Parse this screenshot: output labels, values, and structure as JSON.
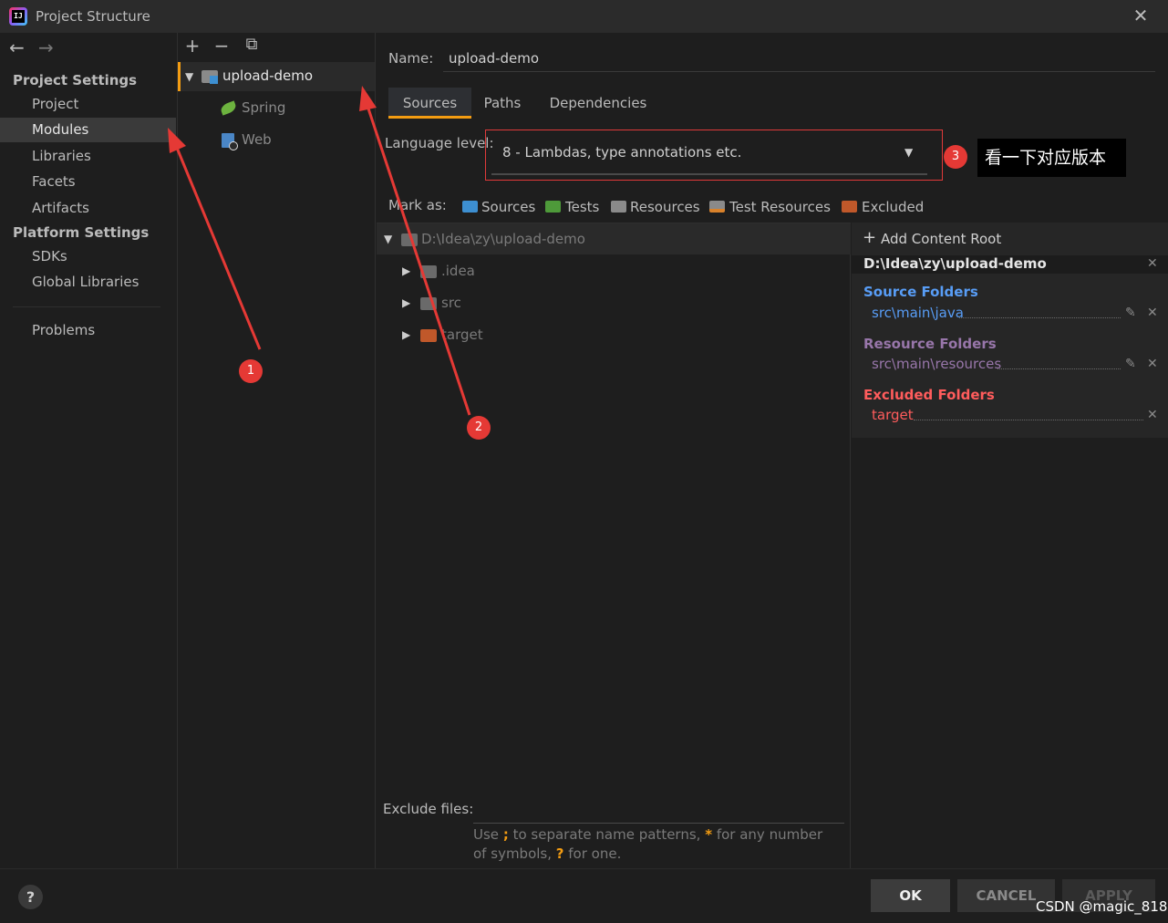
{
  "window": {
    "title": "Project Structure",
    "logo_text": "IJ"
  },
  "nav": {
    "back": "←",
    "forward": "→",
    "project_settings_heading": "Project Settings",
    "items": [
      "Project",
      "Modules",
      "Libraries",
      "Facets",
      "Artifacts"
    ],
    "platform_settings_heading": "Platform Settings",
    "platform_items": [
      "SDKs",
      "Global Libraries"
    ],
    "problems": "Problems"
  },
  "module_toolbar": {
    "add": "+",
    "remove": "−",
    "copy": "⧉"
  },
  "module_tree": {
    "module_name": "upload-demo",
    "children": [
      "Spring",
      "Web"
    ]
  },
  "details": {
    "name_label": "Name:",
    "name_value": "upload-demo",
    "tabs": [
      "Sources",
      "Paths",
      "Dependencies"
    ],
    "language_level_label": "Language level:",
    "language_level_value": "8 - Lambdas, type annotations etc.",
    "mark_as_label": "Mark as:",
    "mark_as": {
      "sources": "Sources",
      "tests": "Tests",
      "resources": "Resources",
      "test_resources": "Test Resources",
      "excluded": "Excluded"
    },
    "content_tree": {
      "root": "D:\\Idea\\zy\\upload-demo",
      "children": [
        ".idea",
        "src",
        "target"
      ]
    },
    "roots": {
      "add_content_root": "Add Content Root",
      "root_path": "D:\\Idea\\zy\\upload-demo",
      "source_folders_heading": "Source Folders",
      "source_folder": "src\\main\\java",
      "resource_folders_heading": "Resource Folders",
      "resource_folder": "src\\main\\resources",
      "excluded_folders_heading": "Excluded Folders",
      "excluded_folder": "target"
    },
    "exclude_files_label": "Exclude files:",
    "exclude_hint_1": "Use",
    "exclude_hint_semicolon": ";",
    "exclude_hint_2": "to separate name patterns,",
    "exclude_hint_star": "*",
    "exclude_hint_3": "for any number of",
    "exclude_hint_4": "symbols,",
    "exclude_hint_q": "?",
    "exclude_hint_5": "for one."
  },
  "annotations": {
    "badge_1": "1",
    "badge_2": "2",
    "badge_3": "3",
    "tooltip": "看一下对应版本"
  },
  "footer": {
    "help": "?",
    "ok": "OK",
    "cancel": "CANCEL",
    "apply": "APPLY",
    "watermark": "CSDN @magic_818"
  },
  "colors": {
    "accent": "#f39c12",
    "source_folders": "#589df6",
    "resource_folders": "#9876aa",
    "excluded_folders": "#ff5c5c",
    "annotation_red": "#e53935"
  }
}
